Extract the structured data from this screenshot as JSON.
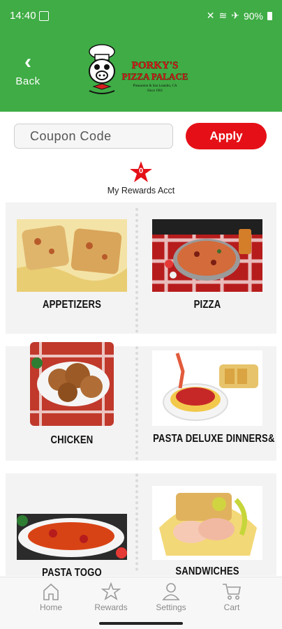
{
  "status": {
    "time": "14:40",
    "battery": "90%"
  },
  "header": {
    "back_label": "Back",
    "logo": {
      "line1": "PORKY'S",
      "line2": "PIZZA PALACE",
      "tagline": "Pleasanton & San Leandro, CA",
      "since": "Since 1961"
    }
  },
  "coupon": {
    "placeholder": "Coupon Code",
    "apply_label": "Apply"
  },
  "rewards": {
    "count": "0",
    "label": "My Rewards Acct"
  },
  "categories": [
    {
      "label": "APPETIZERS",
      "icon": "appetizers-photo"
    },
    {
      "label": "PIZZA",
      "icon": "pizza-photo"
    },
    {
      "label": "CHICKEN",
      "icon": "chicken-photo"
    },
    {
      "label": "PASTA DELUXE DINNERS& ALA",
      "icon": "pasta-deluxe-photo"
    },
    {
      "label": "PASTA TOGO",
      "icon": "pasta-togo-photo"
    },
    {
      "label": "SANDWICHES",
      "icon": "sandwiches-photo"
    }
  ],
  "nav": [
    {
      "label": "Home",
      "icon": "home-icon"
    },
    {
      "label": "Rewards",
      "icon": "star-icon"
    },
    {
      "label": "Settings",
      "icon": "person-icon"
    },
    {
      "label": "Cart",
      "icon": "cart-icon"
    }
  ],
  "colors": {
    "brand_green": "#3fac45",
    "accent_red": "#e51017"
  }
}
